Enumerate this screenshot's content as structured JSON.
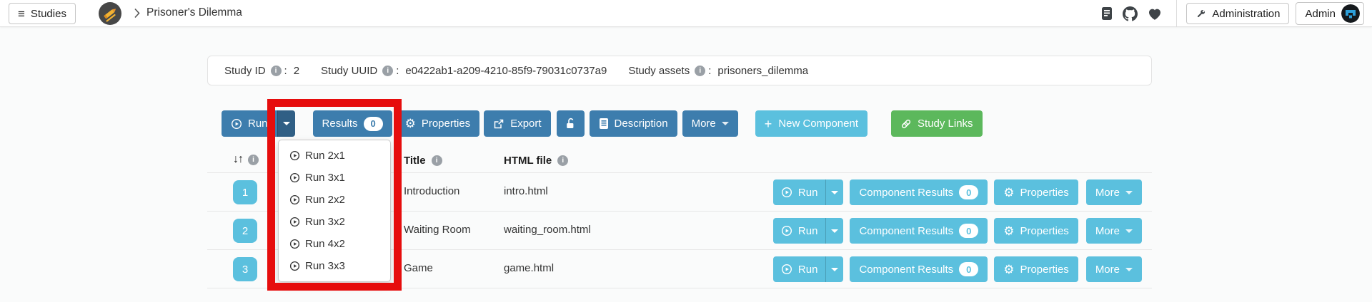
{
  "navbar": {
    "studies_button": "Studies",
    "breadcrumb_current": "Prisoner's Dilemma",
    "administration_button": "Administration",
    "admin_user_button": "Admin"
  },
  "glyphs": {
    "hamburger": "≡",
    "info": "i",
    "plus": "+",
    "order": "↓↑",
    "gear": "⚙"
  },
  "study_info": {
    "separator": ":",
    "id_label": "Study ID",
    "id_value": "2",
    "uuid_label": "Study UUID",
    "uuid_value": "e0422ab1-a209-4210-85f9-79031c0737a9",
    "assets_label": "Study assets",
    "assets_value": "prisoners_dilemma"
  },
  "toolbar": {
    "run_label": "Run",
    "results_label": "Results",
    "results_count": "0",
    "properties_label": "Properties",
    "export_label": "Export",
    "description_label": "Description",
    "more_label": "More",
    "new_component_label": "New Component",
    "study_links_label": "Study Links"
  },
  "run_dropdown": {
    "items": [
      "Run 2x1",
      "Run 3x1",
      "Run 2x2",
      "Run 3x2",
      "Run 4x2",
      "Run 3x3"
    ]
  },
  "components_table": {
    "title_header": "Title",
    "html_file_header": "HTML file",
    "row_run_label": "Run",
    "row_results_label": "Component Results",
    "row_properties_label": "Properties",
    "row_more_label": "More",
    "rows": [
      {
        "order": "1",
        "title": "Introduction",
        "html_file": "intro.html",
        "results_count": "0"
      },
      {
        "order": "2",
        "title": "Waiting Room",
        "html_file": "waiting_room.html",
        "results_count": "0"
      },
      {
        "order": "3",
        "title": "Game",
        "html_file": "game.html",
        "results_count": "0"
      }
    ]
  },
  "colors": {
    "primary_blue": "#3d7dad",
    "teal": "#5bc0de",
    "green": "#5cb85c",
    "annotation_red": "#e60d0d"
  }
}
